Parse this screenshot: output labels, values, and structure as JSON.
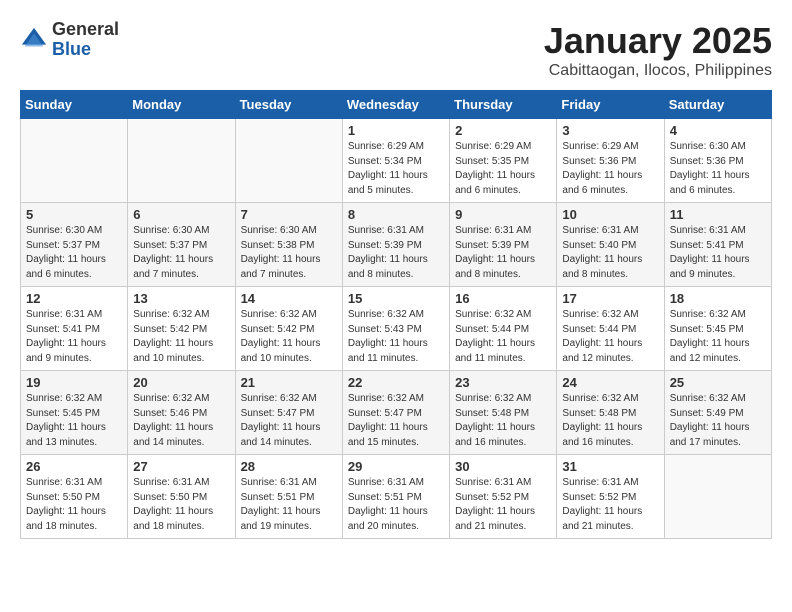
{
  "logo": {
    "general": "General",
    "blue": "Blue"
  },
  "title": "January 2025",
  "subtitle": "Cabittaogan, Ilocos, Philippines",
  "days_of_week": [
    "Sunday",
    "Monday",
    "Tuesday",
    "Wednesday",
    "Thursday",
    "Friday",
    "Saturday"
  ],
  "weeks": [
    [
      {
        "day": "",
        "info": ""
      },
      {
        "day": "",
        "info": ""
      },
      {
        "day": "",
        "info": ""
      },
      {
        "day": "1",
        "info": "Sunrise: 6:29 AM\nSunset: 5:34 PM\nDaylight: 11 hours and 5 minutes."
      },
      {
        "day": "2",
        "info": "Sunrise: 6:29 AM\nSunset: 5:35 PM\nDaylight: 11 hours and 6 minutes."
      },
      {
        "day": "3",
        "info": "Sunrise: 6:29 AM\nSunset: 5:36 PM\nDaylight: 11 hours and 6 minutes."
      },
      {
        "day": "4",
        "info": "Sunrise: 6:30 AM\nSunset: 5:36 PM\nDaylight: 11 hours and 6 minutes."
      }
    ],
    [
      {
        "day": "5",
        "info": "Sunrise: 6:30 AM\nSunset: 5:37 PM\nDaylight: 11 hours and 6 minutes."
      },
      {
        "day": "6",
        "info": "Sunrise: 6:30 AM\nSunset: 5:37 PM\nDaylight: 11 hours and 7 minutes."
      },
      {
        "day": "7",
        "info": "Sunrise: 6:30 AM\nSunset: 5:38 PM\nDaylight: 11 hours and 7 minutes."
      },
      {
        "day": "8",
        "info": "Sunrise: 6:31 AM\nSunset: 5:39 PM\nDaylight: 11 hours and 8 minutes."
      },
      {
        "day": "9",
        "info": "Sunrise: 6:31 AM\nSunset: 5:39 PM\nDaylight: 11 hours and 8 minutes."
      },
      {
        "day": "10",
        "info": "Sunrise: 6:31 AM\nSunset: 5:40 PM\nDaylight: 11 hours and 8 minutes."
      },
      {
        "day": "11",
        "info": "Sunrise: 6:31 AM\nSunset: 5:41 PM\nDaylight: 11 hours and 9 minutes."
      }
    ],
    [
      {
        "day": "12",
        "info": "Sunrise: 6:31 AM\nSunset: 5:41 PM\nDaylight: 11 hours and 9 minutes."
      },
      {
        "day": "13",
        "info": "Sunrise: 6:32 AM\nSunset: 5:42 PM\nDaylight: 11 hours and 10 minutes."
      },
      {
        "day": "14",
        "info": "Sunrise: 6:32 AM\nSunset: 5:42 PM\nDaylight: 11 hours and 10 minutes."
      },
      {
        "day": "15",
        "info": "Sunrise: 6:32 AM\nSunset: 5:43 PM\nDaylight: 11 hours and 11 minutes."
      },
      {
        "day": "16",
        "info": "Sunrise: 6:32 AM\nSunset: 5:44 PM\nDaylight: 11 hours and 11 minutes."
      },
      {
        "day": "17",
        "info": "Sunrise: 6:32 AM\nSunset: 5:44 PM\nDaylight: 11 hours and 12 minutes."
      },
      {
        "day": "18",
        "info": "Sunrise: 6:32 AM\nSunset: 5:45 PM\nDaylight: 11 hours and 12 minutes."
      }
    ],
    [
      {
        "day": "19",
        "info": "Sunrise: 6:32 AM\nSunset: 5:45 PM\nDaylight: 11 hours and 13 minutes."
      },
      {
        "day": "20",
        "info": "Sunrise: 6:32 AM\nSunset: 5:46 PM\nDaylight: 11 hours and 14 minutes."
      },
      {
        "day": "21",
        "info": "Sunrise: 6:32 AM\nSunset: 5:47 PM\nDaylight: 11 hours and 14 minutes."
      },
      {
        "day": "22",
        "info": "Sunrise: 6:32 AM\nSunset: 5:47 PM\nDaylight: 11 hours and 15 minutes."
      },
      {
        "day": "23",
        "info": "Sunrise: 6:32 AM\nSunset: 5:48 PM\nDaylight: 11 hours and 16 minutes."
      },
      {
        "day": "24",
        "info": "Sunrise: 6:32 AM\nSunset: 5:48 PM\nDaylight: 11 hours and 16 minutes."
      },
      {
        "day": "25",
        "info": "Sunrise: 6:32 AM\nSunset: 5:49 PM\nDaylight: 11 hours and 17 minutes."
      }
    ],
    [
      {
        "day": "26",
        "info": "Sunrise: 6:31 AM\nSunset: 5:50 PM\nDaylight: 11 hours and 18 minutes."
      },
      {
        "day": "27",
        "info": "Sunrise: 6:31 AM\nSunset: 5:50 PM\nDaylight: 11 hours and 18 minutes."
      },
      {
        "day": "28",
        "info": "Sunrise: 6:31 AM\nSunset: 5:51 PM\nDaylight: 11 hours and 19 minutes."
      },
      {
        "day": "29",
        "info": "Sunrise: 6:31 AM\nSunset: 5:51 PM\nDaylight: 11 hours and 20 minutes."
      },
      {
        "day": "30",
        "info": "Sunrise: 6:31 AM\nSunset: 5:52 PM\nDaylight: 11 hours and 21 minutes."
      },
      {
        "day": "31",
        "info": "Sunrise: 6:31 AM\nSunset: 5:52 PM\nDaylight: 11 hours and 21 minutes."
      },
      {
        "day": "",
        "info": ""
      }
    ]
  ]
}
